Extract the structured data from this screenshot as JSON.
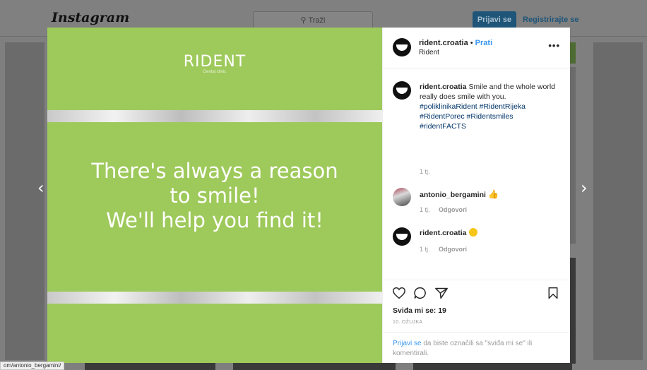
{
  "header": {
    "logo": "Instagram",
    "search_placeholder": "Traži",
    "login_label": "Prijavi se",
    "register_label": "Registrirajte se"
  },
  "post_image": {
    "brand": "RIDENT",
    "brand_sub": "Dental clinic",
    "slogan_lines": [
      "There's always a reason",
      "to smile!",
      "We'll help you find it!"
    ],
    "background_color": "#9ec95b"
  },
  "post_header": {
    "username": "rident.croatia",
    "separator": "•",
    "follow_label": "Prati",
    "location": "Rident",
    "more_icon": "more-icon"
  },
  "caption": {
    "username": "rident.croatia",
    "text": "Smile and the whole world really does smile with you.",
    "hashtags": "#poliklinikaRident #RidentRijeka #RidentPorec #Ridentsmiles #ridentFACTS",
    "time": "1 tj."
  },
  "comments": [
    {
      "username": "antonio_bergamini",
      "emoji": "thumbs-up",
      "time": "1 tj.",
      "reply_label": "Odgovori"
    },
    {
      "username": "rident.croatia",
      "emoji": "smiley",
      "time": "1 tj.",
      "reply_label": "Odgovori"
    }
  ],
  "actions": {
    "like_icon": "heart-icon",
    "comment_icon": "comment-icon",
    "share_icon": "share-icon",
    "save_icon": "bookmark-icon",
    "likes_text": "Sviđa mi se: 19",
    "date": "10. OŽUJKA"
  },
  "login_prompt": {
    "link": "Prijavi se",
    "text": " da biste označili sa \"sviđa mi se\" ili komentirali."
  },
  "nav": {
    "prev": "‹",
    "next": "›"
  },
  "status_url": "om/antonio_bergamini/"
}
